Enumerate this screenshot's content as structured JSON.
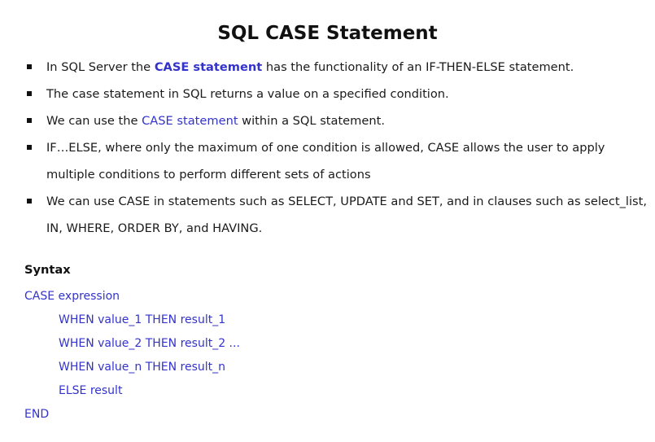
{
  "title": "SQL CASE Statement",
  "bullets": [
    {
      "pre": "In SQL Server the ",
      "highlight": "CASE statement",
      "post": " has the functionality of an IF-THEN-ELSE statement."
    },
    {
      "text": "The case statement in SQL returns a value on a specified condition."
    },
    {
      "pre": "We can use the ",
      "highlight": "CASE statement",
      "post": " within a SQL statement."
    },
    {
      "text": "IF…ELSE, where only the maximum of one condition is allowed, CASE allows the user to apply multiple conditions to perform different sets of actions"
    },
    {
      "text": "We can use CASE in statements such as SELECT, UPDATE and SET, and in clauses such as select_list, IN, WHERE, ORDER BY, and HAVING."
    }
  ],
  "syntax": {
    "heading": "Syntax",
    "lines": [
      "CASE expression",
      "WHEN value_1 THEN result_1",
      "WHEN value_2 THEN result_2 ...",
      "WHEN value_n THEN result_n",
      "ELSE result",
      "END"
    ]
  },
  "colors": {
    "keyword": "#3333cc",
    "text": "#1a1a1a",
    "background": "#ffffff"
  }
}
